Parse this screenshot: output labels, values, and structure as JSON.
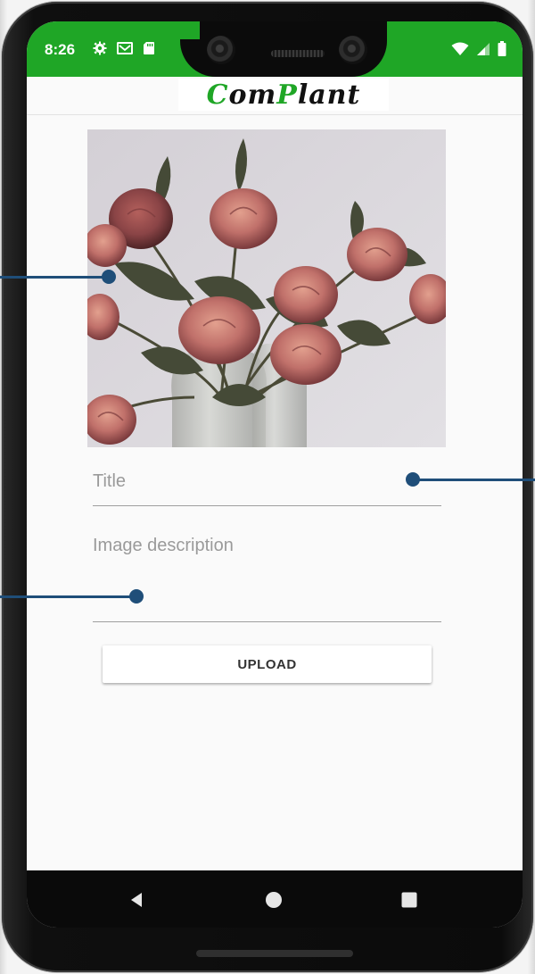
{
  "status_bar": {
    "time": "8:26",
    "left_icons": [
      "gear-icon",
      "mail-icon",
      "sd-card-icon"
    ],
    "right_icons": [
      "wifi-icon",
      "signal-icon",
      "battery-icon"
    ],
    "color": "#1fa626"
  },
  "app_bar": {
    "logo_prefix": "C",
    "logo_mid": "om",
    "logo_accent": "P",
    "logo_suffix": "lant",
    "accent_color": "#1fa626"
  },
  "image": {
    "subject": "plant-photo"
  },
  "form": {
    "title_placeholder": "Title",
    "description_placeholder": "Image description",
    "upload_label": "UPLOAD"
  },
  "nav_bar": {
    "icons": [
      "back-icon",
      "home-icon",
      "recents-icon"
    ]
  },
  "annotation_color": "#1f4e79"
}
